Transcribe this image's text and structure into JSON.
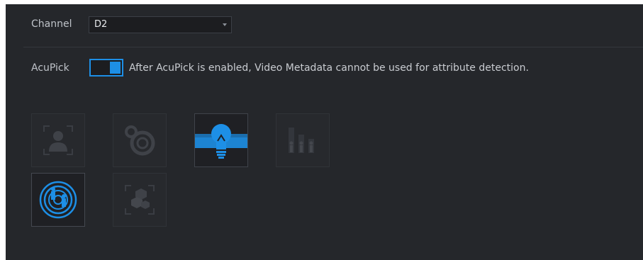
{
  "channel": {
    "label": "Channel",
    "value": "D2"
  },
  "acupick": {
    "label": "AcuPick",
    "enabled": true,
    "note": "After AcuPick is enabled, Video Metadata cannot be used for attribute detection."
  },
  "features": [
    {
      "icon": "face-detection-icon",
      "state": "disabled"
    },
    {
      "icon": "face-recognition-icon",
      "state": "disabled"
    },
    {
      "icon": "smart-plan-bulb-icon",
      "state": "selected"
    },
    {
      "icon": "people-counting-icon",
      "state": "disabled"
    },
    {
      "icon": "perimeter-protection-icon",
      "state": "active"
    },
    {
      "icon": "object-detection-icon",
      "state": "disabled"
    }
  ],
  "colors": {
    "accent": "#1d8fe6",
    "background": "#25272b"
  }
}
